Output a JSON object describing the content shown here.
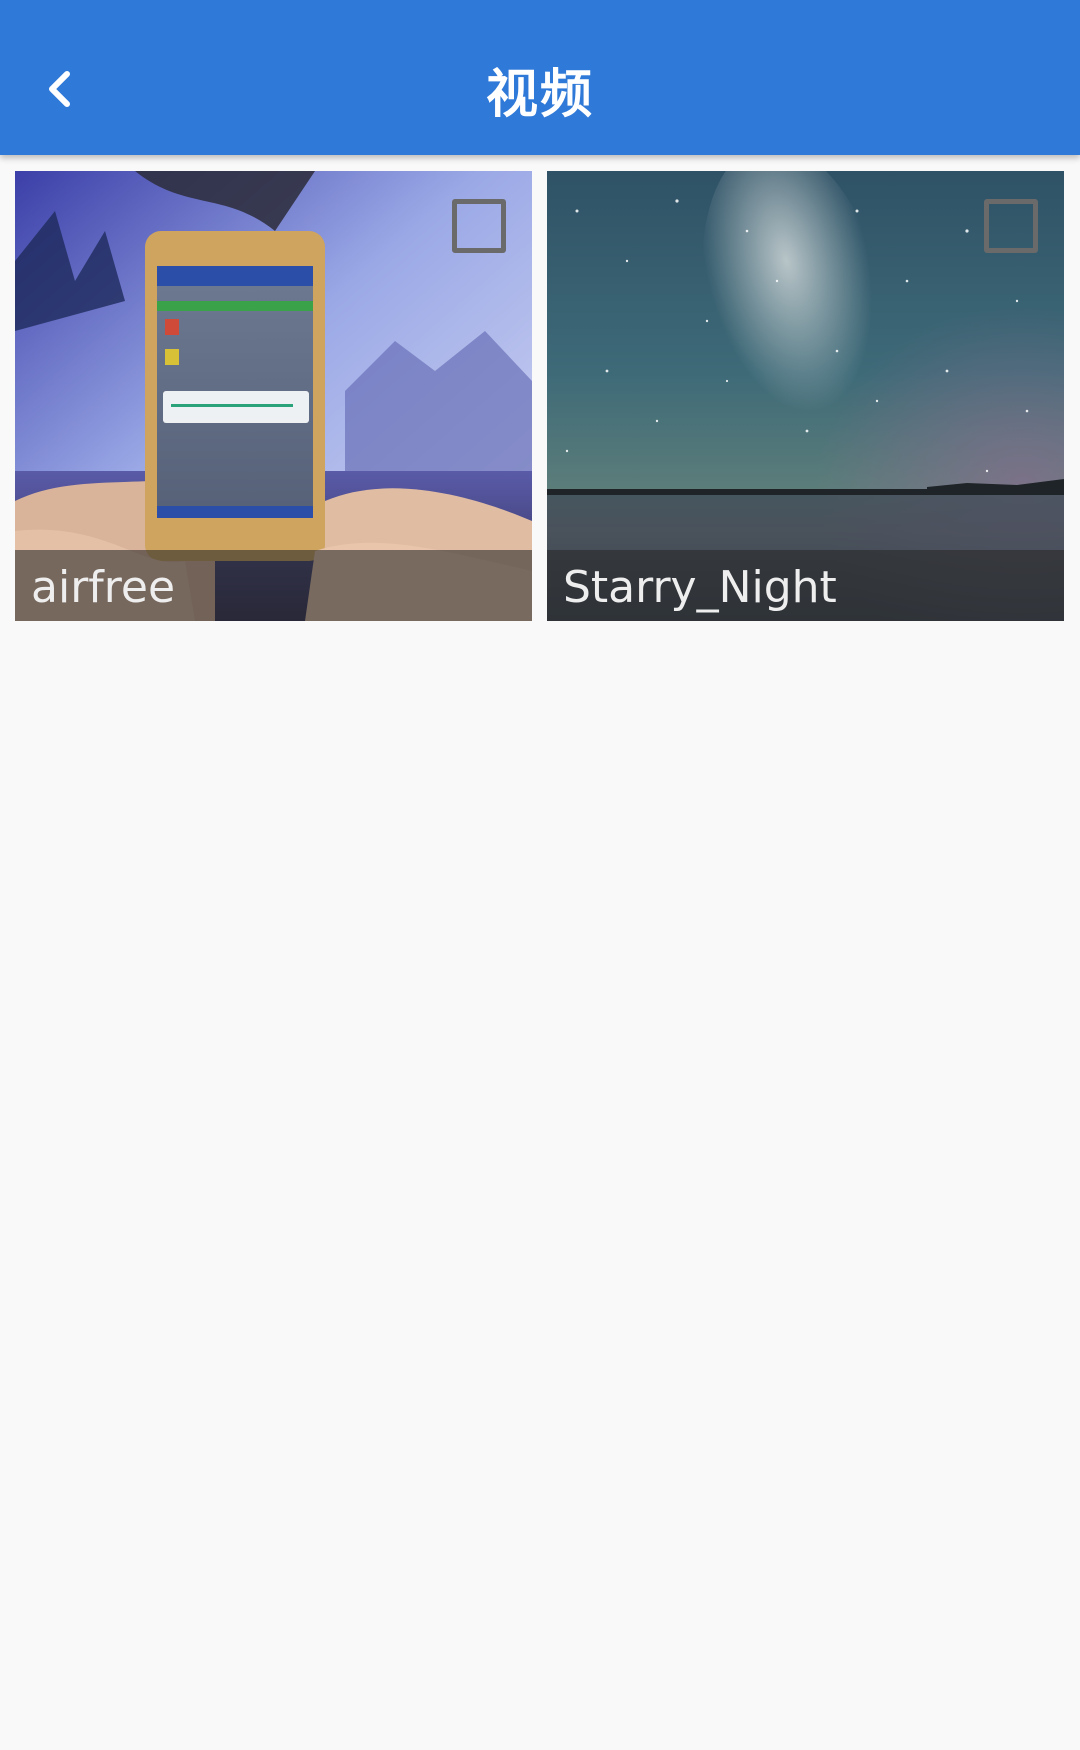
{
  "header": {
    "title": "视频",
    "back_icon": "chevron-left-icon",
    "background": "#2f79d8"
  },
  "videos": [
    {
      "name": "airfree",
      "selected": false
    },
    {
      "name": "Starry_Night",
      "selected": false
    }
  ]
}
